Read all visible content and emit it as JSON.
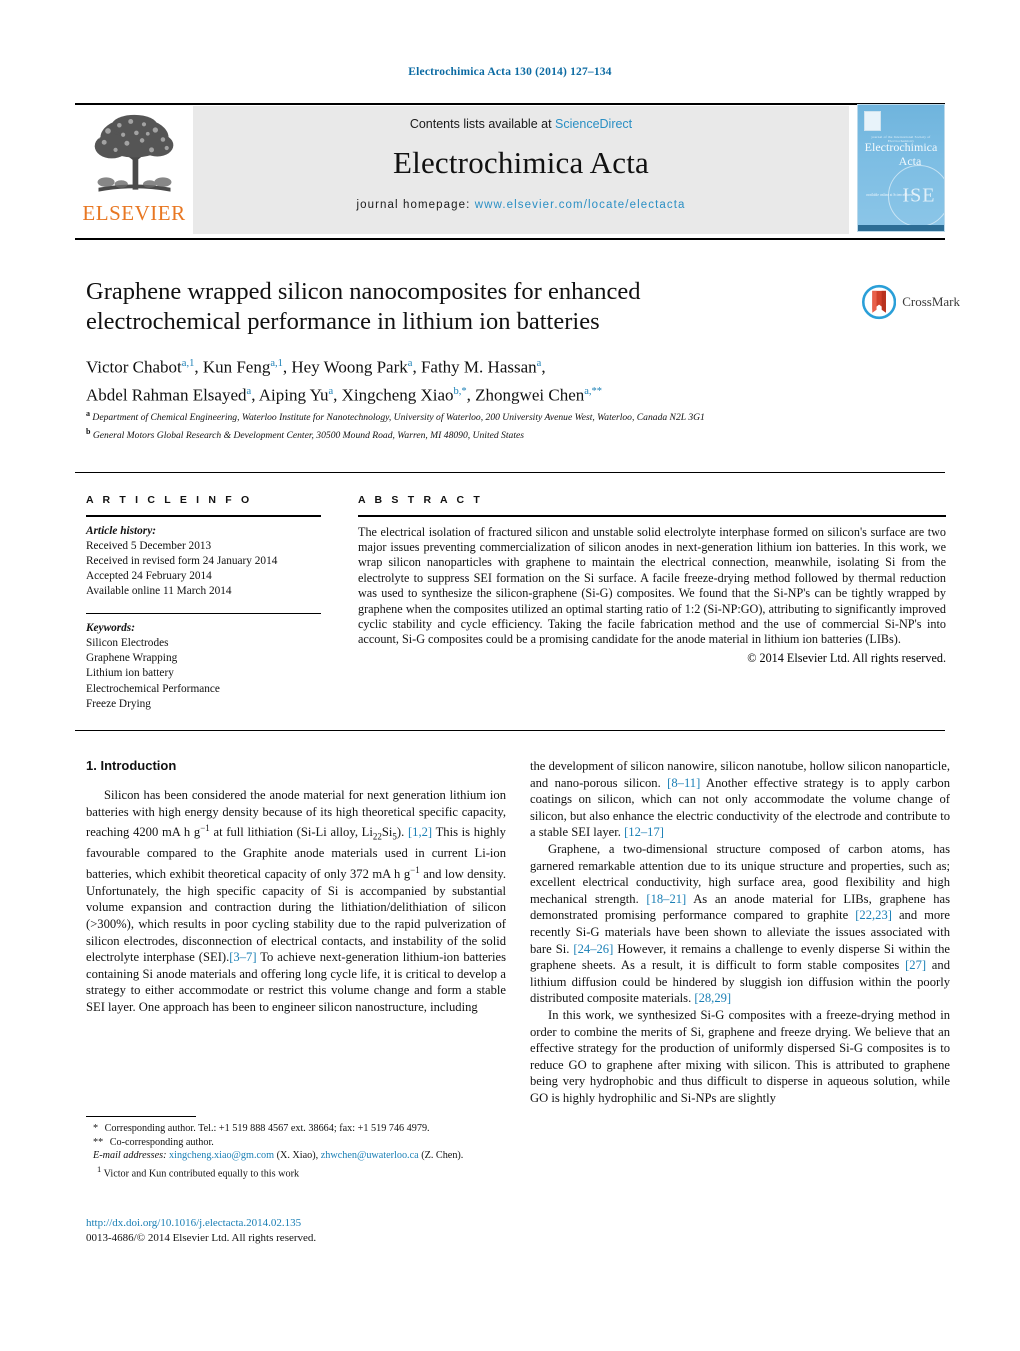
{
  "running_head": "Electrochimica Acta 130 (2014) 127–134",
  "masthead": {
    "publisher_wordmark": "ELSEVIER",
    "contents_prefix": "Contents lists available at",
    "contents_link": "ScienceDirect",
    "journal_title": "Electrochimica Acta",
    "homepage_prefix": "journal homepage:",
    "homepage_url": "www.elsevier.com/locate/electacta",
    "cover": {
      "top_caption": "journal of the International Society of Electrochemistry",
      "title_line1": "Electrochimica",
      "title_line2": "Acta",
      "sciencedirect_caption": "available online at ScienceDirect",
      "seal_text": "ISE"
    }
  },
  "article": {
    "title": "Graphene wrapped silicon nanocomposites for enhanced electrochemical performance in lithium ion batteries",
    "authors_line1": "Victor Chabot<sup>a,1</sup>, Kun Feng<sup>a,1</sup>, Hey Woong Park<sup>a</sup>, Fathy M. Hassan<sup>a</sup>,",
    "authors_line2": "Abdel Rahman Elsayed<sup>a</sup>, Aiping Yu<sup>a</sup>, Xingcheng Xiao<sup>b,*</sup>, Zhongwei Chen<sup>a,**</sup>",
    "affiliation_a": "<sup>a</sup> Department of Chemical Engineering, Waterloo Institute for Nanotechnology, University of Waterloo, 200 University Avenue West, Waterloo, Canada N2L 3G1",
    "affiliation_b": "<sup>b</sup> General Motors Global Research &amp; Development Center, 30500 Mound Road, Warren, MI 48090, United States",
    "crossmark_label": "CrossMark"
  },
  "article_info": {
    "heading": "A R T I C L E   I N F O",
    "history_label": "Article history:",
    "history": [
      "Received 5 December 2013",
      "Received in revised form 24 January 2014",
      "Accepted 24 February 2014",
      "Available online 11 March 2014"
    ],
    "keywords_label": "Keywords:",
    "keywords": [
      "Silicon Electrodes",
      "Graphene Wrapping",
      "Lithium ion battery",
      "Electrochemical Performance",
      "Freeze Drying"
    ]
  },
  "abstract": {
    "heading": "A B S T R A C T",
    "text": "The electrical isolation of fractured silicon and unstable solid electrolyte interphase formed on silicon's surface are two major issues preventing commercialization of silicon anodes in next-generation lithium ion batteries. In this work, we wrap silicon nanoparticles with graphene to maintain the electrical connection, meanwhile, isolating Si from the electrolyte to suppress SEI formation on the Si surface. A facile freeze-drying method followed by thermal reduction was used to synthesize the silicon-graphene (Si-G) composites. We found that the Si-NP's can be tightly wrapped by graphene when the composites utilized an optimal starting ratio of 1:2 (Si-NP:GO), attributing to significantly improved cyclic stability and cycle efficiency. Taking the facile fabrication method and the use of commercial Si-NP's into account, Si-G composites could be a promising candidate for the anode material in lithium ion batteries (LIBs).",
    "copyright": "© 2014 Elsevier Ltd. All rights reserved."
  },
  "body": {
    "section_heading": "1.  Introduction",
    "left_paragraph_1": "Silicon has been considered the anode material for next generation lithium ion batteries with high energy density because of its high theoretical specific capacity, reaching 4200 mA h g<sup class=\"num\">−1</sup> at full lithiation (Si-Li alloy, Li<sub>22</sub>Si<sub>5</sub>). <span class=\"ref\">[1,2]</span> This is highly favourable compared to the Graphite anode materials used in current Li-ion batteries, which exhibit theoretical capacity of only 372 mA h g<sup class=\"num\">−1</sup> and low density. Unfortunately, the high specific capacity of Si is accompanied by substantial volume expansion and contraction during the lithiation/delithiation of silicon (&gt;300%), which results in poor cycling stability due to the rapid pulverization of silicon electrodes, disconnection of electrical contacts, and instability of the solid electrolyte interphase (SEI).<span class=\"ref\">[3–7]</span> To achieve next-generation lithium-ion batteries containing Si anode materials and offering long cycle life, it is critical to develop a strategy to either accommodate or restrict this volume change and form a stable SEI layer. One approach has been to engineer silicon nanostructure, including",
    "right_paragraph_1": "the development of silicon nanowire, silicon nanotube, hollow silicon nanoparticle, and nano-porous silicon. <span class=\"ref\">[8–11]</span> Another effective strategy is to apply carbon coatings on silicon, which can not only accommodate the volume change of silicon, but also enhance the electric conductivity of the electrode and contribute to a stable SEI layer. <span class=\"ref\">[12–17]</span>",
    "right_paragraph_2": "Graphene, a two-dimensional structure composed of carbon atoms, has garnered remarkable attention due to its unique structure and properties, such as; excellent electrical conductivity, high surface area, good flexibility and high mechanical strength. <span class=\"ref\">[18–21]</span> As an anode material for LIBs, graphene has demonstrated promising performance compared to graphite <span class=\"ref\">[22,23]</span> and more recently Si-G materials have been shown to alleviate the issues associated with bare Si. <span class=\"ref\">[24–26]</span> However, it remains a challenge to evenly disperse Si within the graphene sheets. As a result, it is difficult to form stable composites <span class=\"ref\">[27]</span> and lithium diffusion could be hindered by sluggish ion diffusion within the poorly distributed composite materials. <span class=\"ref\">[28,29]</span>",
    "right_paragraph_3": "In this work, we synthesized Si-G composites with a freeze-drying method in order to combine the merits of Si, graphene and freeze drying. We believe that an effective strategy for the production of uniformly dispersed Si-G composites is to reduce GO to graphene after mixing with silicon. This is attributed to graphene being very hydrophobic and thus difficult to disperse in aqueous solution, while GO is highly hydrophilic and Si-NPs are slightly"
  },
  "footnotes": {
    "corresponding": "<span class=\"star\">*</span> Corresponding author. Tel.: +1 519 888 4567 ext. 38664; fax: +1 519 746 4979.",
    "co_corresponding": "<span class=\"star\">**</span> Co-corresponding author.",
    "emails": "<i>E-mail addresses:</i> <span class=\"link\">xingcheng.xiao@gm.com</span> (X. Xiao), <span class=\"link\">zhwchen@uwaterloo.ca</span> (Z. Chen).",
    "equal_contribution": "<sup>1</sup> Victor and Kun contributed equally to this work",
    "doi": "http://dx.doi.org/10.1016/j.electacta.2014.02.135",
    "issn": "0013-4686/© 2014 Elsevier Ltd. All rights reserved."
  },
  "colors": {
    "link_blue": "#1a7fb5",
    "header_blue": "#0b6aa2",
    "elsevier_orange": "#e87722",
    "masthead_grey": "#e9e9e9",
    "cover_blue": "#7cbde3"
  }
}
